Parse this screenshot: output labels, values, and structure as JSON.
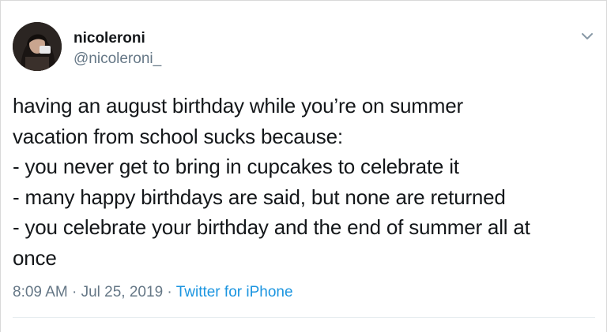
{
  "user": {
    "display_name": "nicoleroni",
    "handle": "@nicoleroni_",
    "avatar_icon": "profile-photo"
  },
  "tweet": {
    "lines": [
      "having an august birthday while you’re on summer",
      "vacation from school sucks because:",
      "- you never get to bring in cupcakes to celebrate it",
      "- many happy birthdays are said, but none are returned",
      "- you celebrate your birthday and the end of summer all at",
      "once"
    ]
  },
  "meta": {
    "time": "8:09 AM",
    "separator": "·",
    "date": "Jul 25, 2019",
    "source": "Twitter for iPhone"
  },
  "icons": {
    "menu": "chevron-down-icon"
  },
  "colors": {
    "text": "#14171a",
    "secondary": "#657786",
    "link": "#1b95e0"
  }
}
